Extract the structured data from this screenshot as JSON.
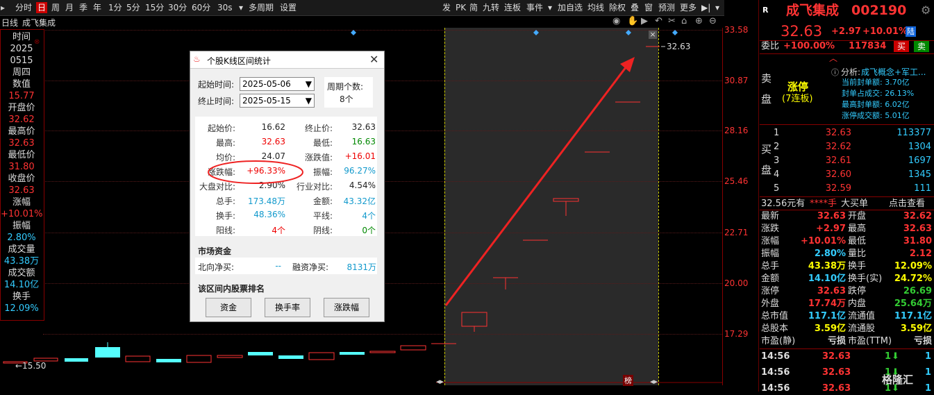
{
  "toolbar": {
    "left_items": [
      "分时",
      "日",
      "周",
      "月",
      "季",
      "年",
      "1分",
      "5分",
      "15分",
      "30分",
      "60分",
      "30s",
      "多周期",
      "设置"
    ],
    "active_item": "日",
    "right_items": [
      "发",
      "PK",
      "简",
      "九转",
      "连板",
      "事件",
      "加自选",
      "均线",
      "除权",
      "叠",
      "窗",
      "预测",
      "更多"
    ]
  },
  "subbar": {
    "period": "日线",
    "stock_name": "成飞集成"
  },
  "left_info": {
    "time_label": "时间",
    "year": "2025",
    "date": "0515",
    "weekday": "周四",
    "value_label": "数值",
    "value": "15.77",
    "open_label": "开盘价",
    "open": "32.62",
    "high_label": "最高价",
    "high": "32.63",
    "low_label": "最低价",
    "low": "31.80",
    "close_label": "收盘价",
    "close": "32.63",
    "change_label": "涨幅",
    "change": "+10.01%",
    "amplitude_label": "振幅",
    "amplitude": "2.80%",
    "volume_label": "成交量",
    "volume": "43.38万",
    "turnover_label": "成交额",
    "turnover": "14.10亿",
    "rate_label": "换手",
    "rate": "12.09%"
  },
  "price_axis": [
    "33.58",
    "30.87",
    "28.16",
    "25.46",
    "22.71",
    "20.00",
    "17.29"
  ],
  "chart_labels": {
    "last_price": "32.63",
    "low_marker": "←15.50",
    "rank_badge": "榜"
  },
  "dialog": {
    "title": "个股K线区间统计",
    "start_label": "起始时间:",
    "start_value": "2025-05-06",
    "end_label": "终止时间:",
    "end_value": "2025-05-15",
    "period_count_label": "周期个数:",
    "period_count": "8个",
    "stats": [
      {
        "k1": "起始价:",
        "v1": "16.62",
        "c1": "#222",
        "k2": "终止价:",
        "v2": "32.63",
        "c2": "#222"
      },
      {
        "k1": "最高:",
        "v1": "32.63",
        "c1": "#e00",
        "k2": "最低:",
        "v2": "16.63",
        "c2": "#080"
      },
      {
        "k1": "均价:",
        "v1": "24.07",
        "c1": "#222",
        "k2": "涨跌值:",
        "v2": "+16.01",
        "c2": "#e00"
      },
      {
        "k1": "涨跌幅:",
        "v1": "+96.33%",
        "c1": "#e00",
        "k2": "振幅:",
        "v2": "96.27%",
        "c2": "#19c"
      },
      {
        "k1": "大盘对比:",
        "v1": "2.90%",
        "c1": "#222",
        "k2": "行业对比:",
        "v2": "4.54%",
        "c2": "#222"
      },
      {
        "k1": "总手:",
        "v1": "173.48万",
        "c1": "#19c",
        "k2": "金额:",
        "v2": "43.32亿",
        "c2": "#19c"
      },
      {
        "k1": "换手:",
        "v1": "48.36%",
        "c1": "#19c",
        "k2": "平线:",
        "v2": "4个",
        "c2": "#19c"
      },
      {
        "k1": "阳线:",
        "v1": "4个",
        "c1": "#e00",
        "k2": "阴线:",
        "v2": "0个",
        "c2": "#080"
      }
    ],
    "market_funds_title": "市场资金",
    "north_label": "北向净买:",
    "north_value": "--",
    "margin_label": "融资净买:",
    "margin_value": "8131万",
    "ranking_title": "该区间内股票排名",
    "buttons": [
      "资金",
      "换手率",
      "涨跌幅"
    ]
  },
  "right_panel": {
    "badge": "R",
    "name": "成飞集成",
    "code": "002190",
    "price": "32.63",
    "change": "+2.97",
    "change_pct": "+10.01%",
    "exchange": "陆",
    "weibi_label": "委比",
    "weibi": "+100.00%",
    "weicha": "117834",
    "sell_btn": "买",
    "buy_btn": "卖",
    "sell_side": "卖\n盘",
    "limit_status": "涨停",
    "limit_days": "(7连板)",
    "analysis_label": "分析:",
    "analysis_text": "成飞概念+军工...",
    "limit_stats": [
      "当前封单额: 3.70亿",
      "封单占成交: 26.13%",
      "最高封单额: 6.02亿",
      "涨停成交额: 5.01亿"
    ],
    "buy_side": "买\n盘",
    "bids": [
      {
        "level": "1",
        "price": "32.63",
        "vol": "113377"
      },
      {
        "level": "2",
        "price": "32.62",
        "vol": "1304"
      },
      {
        "level": "3",
        "price": "32.61",
        "vol": "1697"
      },
      {
        "level": "4",
        "price": "32.60",
        "vol": "1345"
      },
      {
        "level": "5",
        "price": "32.59",
        "vol": "111"
      }
    ],
    "bigorder_price": "32.56元有",
    "bigorder_stars": "****手",
    "bigorder_label": "大买单",
    "bigorder_link": "点击查看",
    "quote_rows": [
      {
        "k1": "最新",
        "v1": "32.63",
        "c1": "#f33",
        "k2": "开盘",
        "v2": "32.62",
        "c2": "#f33"
      },
      {
        "k1": "涨跌",
        "v1": "+2.97",
        "c1": "#f33",
        "k2": "最高",
        "v2": "32.63",
        "c2": "#f33"
      },
      {
        "k1": "涨幅",
        "v1": "+10.01%",
        "c1": "#f33",
        "k2": "最低",
        "v2": "31.80",
        "c2": "#f33"
      },
      {
        "k1": "振幅",
        "v1": "2.80%",
        "c1": "#3cf",
        "k2": "量比",
        "v2": "2.12",
        "c2": "#f33"
      },
      {
        "k1": "总手",
        "v1": "43.38万",
        "c1": "#ff0",
        "k2": "换手",
        "v2": "12.09%",
        "c2": "#ff0"
      },
      {
        "k1": "金额",
        "v1": "14.10亿",
        "c1": "#3cf",
        "k2": "换手(实)",
        "v2": "24.72%",
        "c2": "#ff0"
      },
      {
        "k1": "涨停",
        "v1": "32.63",
        "c1": "#f33",
        "k2": "跌停",
        "v2": "26.69",
        "c2": "#3c3"
      },
      {
        "k1": "外盘",
        "v1": "17.74万",
        "c1": "#f33",
        "k2": "内盘",
        "v2": "25.64万",
        "c2": "#3c3"
      },
      {
        "k1": "总市值",
        "v1": "117.1亿",
        "c1": "#3cf",
        "k2": "流通值",
        "v2": "117.1亿",
        "c2": "#3cf"
      },
      {
        "k1": "总股本",
        "v1": "3.59亿",
        "c1": "#ff0",
        "k2": "流通股",
        "v2": "3.59亿",
        "c2": "#ff0"
      },
      {
        "k1": "市盈(静)",
        "v1": "亏损",
        "c1": "#ddd",
        "k2": "市盈(TTM)",
        "v2": "亏损",
        "c2": "#ddd"
      }
    ],
    "ticks": [
      {
        "time": "14:56",
        "price": "32.63",
        "vol": "1",
        "n": "1"
      },
      {
        "time": "14:56",
        "price": "32.63",
        "vol": "1",
        "n": "1"
      },
      {
        "time": "14:56",
        "price": "32.63",
        "vol": "1",
        "n": "1"
      }
    ],
    "watermark": "格隆汇"
  }
}
